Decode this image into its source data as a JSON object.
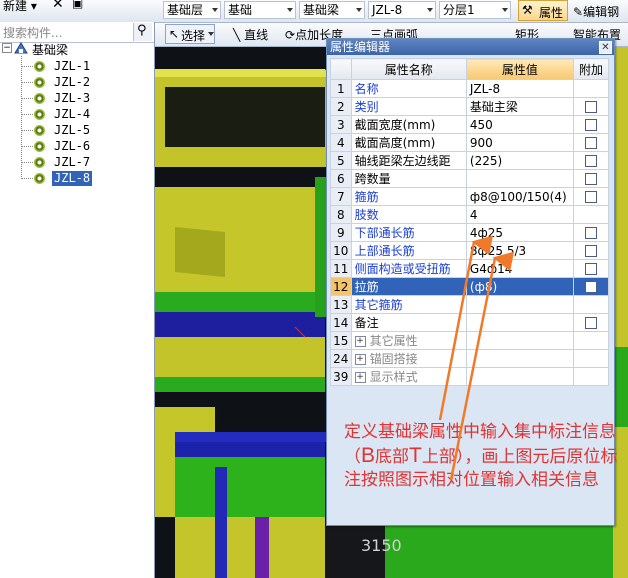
{
  "toolbar": {
    "new_label": "新建",
    "layer_select": "基础层",
    "category_select": "基础",
    "type_select": "基础梁",
    "component_select": "JZL-8",
    "sublayer_select": "分层1",
    "properties_button": "属性",
    "edit_rebar_button": "编辑钢",
    "select_button": "选择",
    "line_button": "直线",
    "point_extend_button": "点加长度",
    "three_point_arc": "三点画弧",
    "rect_button": "矩形",
    "smart_layout_button": "智能布置"
  },
  "search": {
    "placeholder": "搜索构件..."
  },
  "tree": {
    "root": "基础梁",
    "items": [
      "JZL-1",
      "JZL-2",
      "JZL-3",
      "JZL-4",
      "JZL-5",
      "JZL-6",
      "JZL-7",
      "JZL-8"
    ],
    "selected_index": 7
  },
  "dialog": {
    "title": "属性编辑器",
    "headers": {
      "name": "属性名称",
      "value": "属性值",
      "extra": "附加"
    },
    "rows": [
      {
        "num": "1",
        "name": "名称",
        "value": "JZL-8",
        "style": "blue",
        "check": false
      },
      {
        "num": "2",
        "name": "类别",
        "value": "基础主梁",
        "style": "blue",
        "check": true
      },
      {
        "num": "3",
        "name": "截面宽度(mm)",
        "value": "450",
        "style": "black",
        "check": true
      },
      {
        "num": "4",
        "name": "截面高度(mm)",
        "value": "900",
        "style": "black",
        "check": true
      },
      {
        "num": "5",
        "name": "轴线距梁左边线距",
        "value": "(225)",
        "style": "black",
        "check": true
      },
      {
        "num": "6",
        "name": "跨数量",
        "value": "",
        "style": "black",
        "check": true
      },
      {
        "num": "7",
        "name": "箍筋",
        "value": "ф8@100/150(4)",
        "style": "blue",
        "check": true
      },
      {
        "num": "8",
        "name": "肢数",
        "value": "4",
        "style": "blue",
        "check": false
      },
      {
        "num": "9",
        "name": "下部通长筋",
        "value": "4ф25",
        "style": "blue",
        "check": true
      },
      {
        "num": "10",
        "name": "上部通长筋",
        "value": "8ф25 5/3",
        "style": "blue",
        "check": true
      },
      {
        "num": "11",
        "name": "侧面构造或受扭筋",
        "value": "G4ф14",
        "style": "blue",
        "check": true
      },
      {
        "num": "12",
        "name": "拉筋",
        "value": "(ф8)",
        "style": "blue",
        "check": true,
        "selected": true
      },
      {
        "num": "13",
        "name": "其它箍筋",
        "value": "",
        "style": "blue",
        "check": false
      },
      {
        "num": "14",
        "name": "备注",
        "value": "",
        "style": "black",
        "check": true
      },
      {
        "num": "15",
        "name": "其它属性",
        "value": "",
        "style": "gray",
        "expand": true
      },
      {
        "num": "24",
        "name": "锚固搭接",
        "value": "",
        "style": "gray",
        "expand": true
      },
      {
        "num": "39",
        "name": "显示样式",
        "value": "",
        "style": "gray",
        "expand": true
      }
    ]
  },
  "annotation": {
    "parts": [
      {
        "text": "定义基础梁属性中输入集中标注信息（",
        "big": false
      },
      {
        "text": "B",
        "big": true
      },
      {
        "text": "底部",
        "big": false
      },
      {
        "text": "T",
        "big": true
      },
      {
        "text": "上部），画上图元后原位标注按照图示相对位置输入相关信息",
        "big": false
      }
    ]
  },
  "scene": {
    "dimension_label": "3150"
  },
  "colors": {
    "beam_yellow": "#c7c82a",
    "slab_green": "#2fb21d",
    "beam_blue": "#1e28b8",
    "annotation_red": "#e03333",
    "selection_blue": "#3163b8"
  }
}
